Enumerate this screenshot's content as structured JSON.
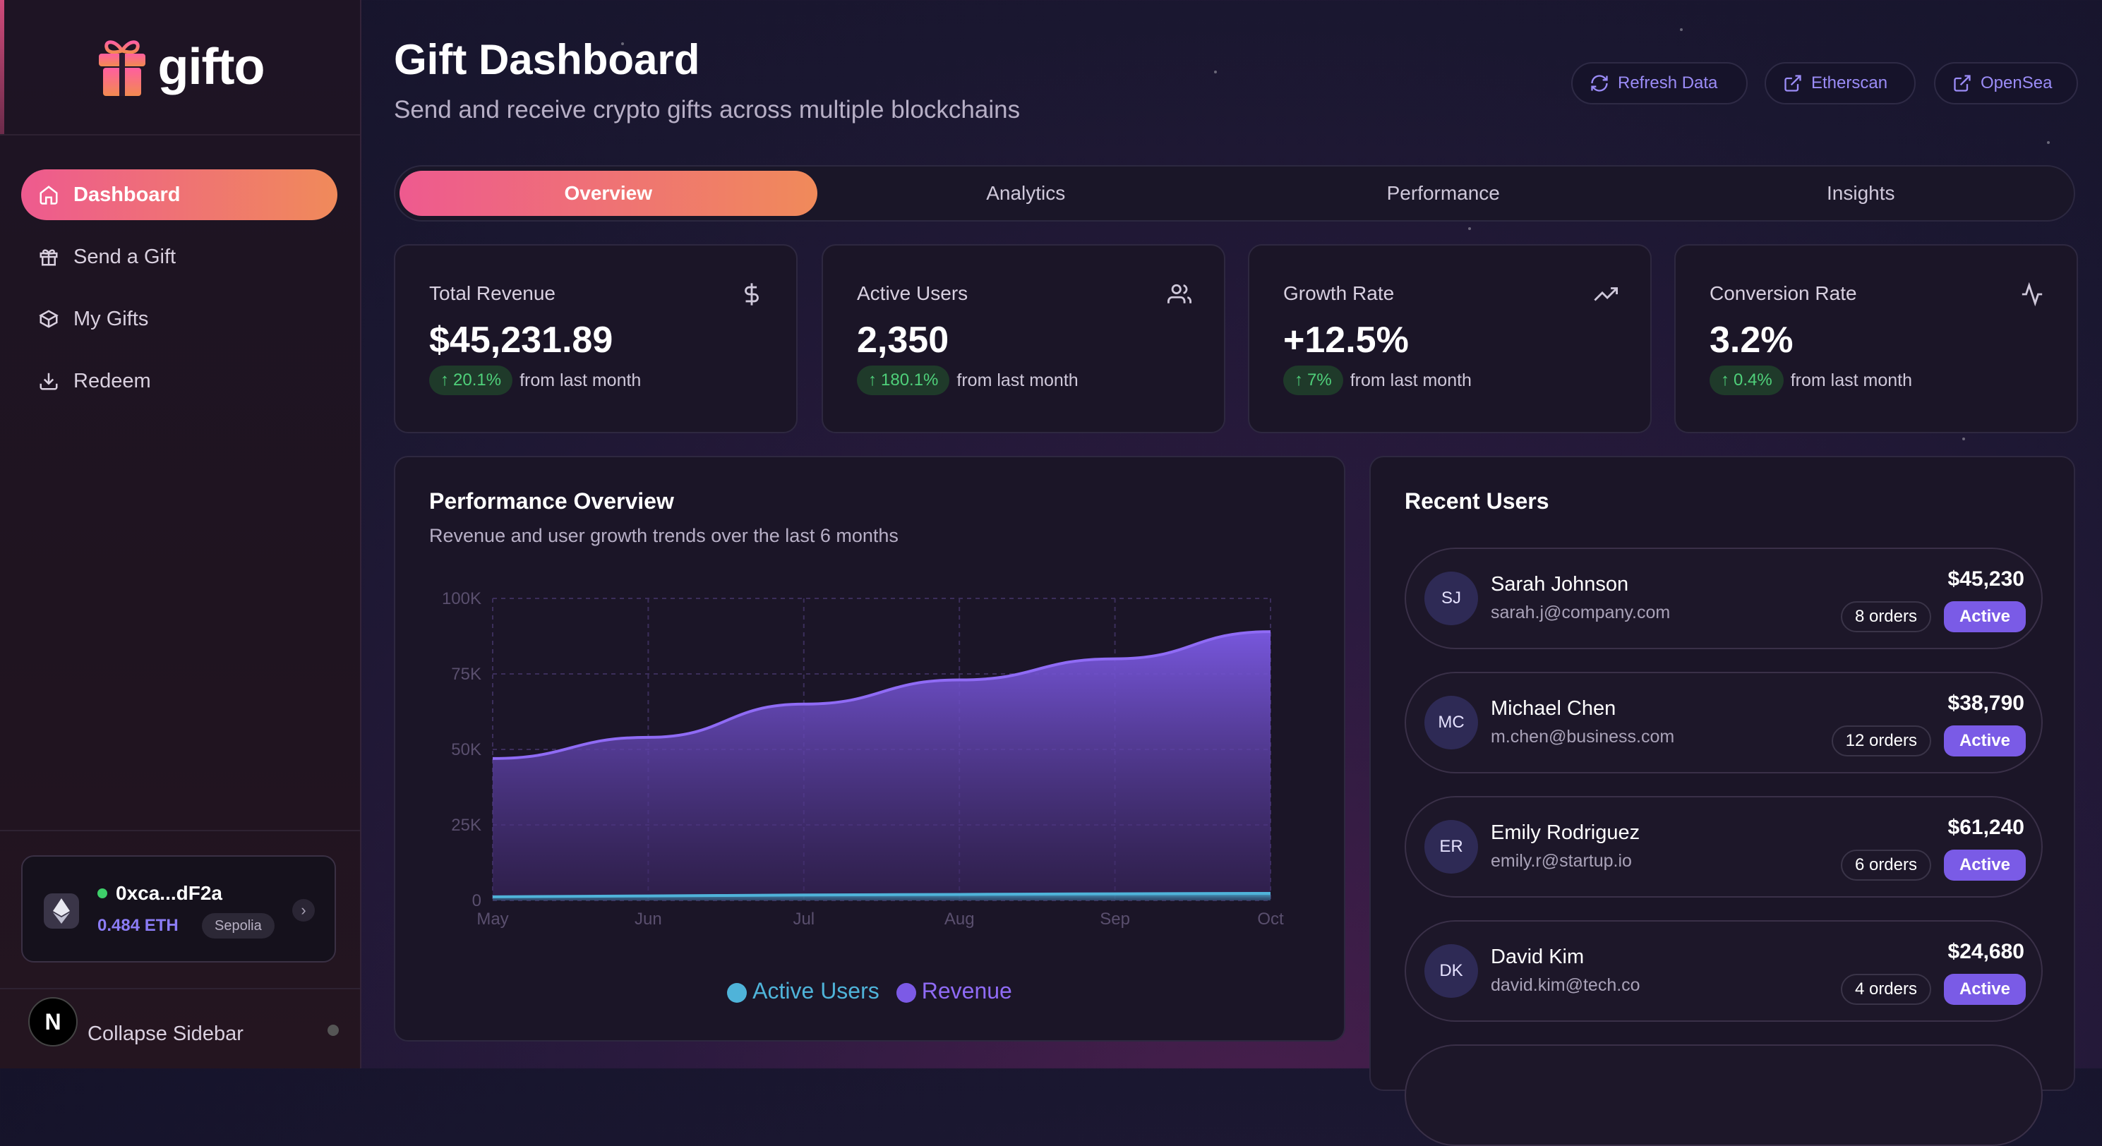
{
  "brand": {
    "name": "gifto"
  },
  "sidebar": {
    "items": [
      {
        "label": "Dashboard",
        "icon": "home-icon",
        "active": true
      },
      {
        "label": "Send a Gift",
        "icon": "gift-icon"
      },
      {
        "label": "My Gifts",
        "icon": "box-icon"
      },
      {
        "label": "Redeem",
        "icon": "download-icon"
      }
    ],
    "wallet": {
      "address": "0xca...dF2a",
      "balance": "0.484 ETH",
      "network": "Sepolia"
    },
    "collapse_label": "Collapse Sidebar",
    "collapse_badge": "N"
  },
  "header": {
    "title": "Gift Dashboard",
    "subtitle": "Send and receive crypto gifts across multiple blockchains",
    "buttons": [
      {
        "label": "Refresh Data",
        "icon": "refresh-icon"
      },
      {
        "label": "Etherscan",
        "icon": "external-link-icon"
      },
      {
        "label": "OpenSea",
        "icon": "external-link-icon"
      }
    ]
  },
  "tabs": [
    "Overview",
    "Analytics",
    "Performance",
    "Insights"
  ],
  "stats": [
    {
      "label": "Total Revenue",
      "value": "$45,231.89",
      "change": "20.1%",
      "suffix": "from last month",
      "icon": "dollar-icon"
    },
    {
      "label": "Active Users",
      "value": "2,350",
      "change": "180.1%",
      "suffix": "from last month",
      "icon": "users-icon"
    },
    {
      "label": "Growth Rate",
      "value": "+12.5%",
      "change": "7%",
      "suffix": "from last month",
      "icon": "trending-up-icon"
    },
    {
      "label": "Conversion Rate",
      "value": "3.2%",
      "change": "0.4%",
      "suffix": "from last month",
      "icon": "activity-icon"
    }
  ],
  "performance": {
    "title": "Performance Overview",
    "subtitle": "Revenue and user growth trends over the last 6 months"
  },
  "chart_data": {
    "type": "area",
    "categories": [
      "May",
      "Jun",
      "Jul",
      "Aug",
      "Sep",
      "Oct"
    ],
    "ylim": [
      0,
      100000
    ],
    "yticks": [
      "0",
      "25K",
      "50K",
      "75K",
      "100K"
    ],
    "series": [
      {
        "name": "Active Users",
        "color": "#4fb3d9",
        "values": [
          1200,
          1500,
          1800,
          2000,
          2200,
          2350
        ]
      },
      {
        "name": "Revenue",
        "color": "#7c5ae6",
        "values": [
          47000,
          54000,
          65000,
          73000,
          80000,
          89000
        ]
      }
    ],
    "grid": true,
    "legend": "bottom"
  },
  "recent_users": {
    "title": "Recent Users",
    "users": [
      {
        "initials": "SJ",
        "name": "Sarah Johnson",
        "email": "sarah.j@company.com",
        "amount": "$45,230",
        "orders": "8 orders",
        "status": "Active"
      },
      {
        "initials": "MC",
        "name": "Michael Chen",
        "email": "m.chen@business.com",
        "amount": "$38,790",
        "orders": "12 orders",
        "status": "Active"
      },
      {
        "initials": "ER",
        "name": "Emily Rodriguez",
        "email": "emily.r@startup.io",
        "amount": "$61,240",
        "orders": "6 orders",
        "status": "Active"
      },
      {
        "initials": "DK",
        "name": "David Kim",
        "email": "david.kim@tech.co",
        "amount": "$24,680",
        "orders": "4 orders",
        "status": "Active"
      }
    ]
  }
}
